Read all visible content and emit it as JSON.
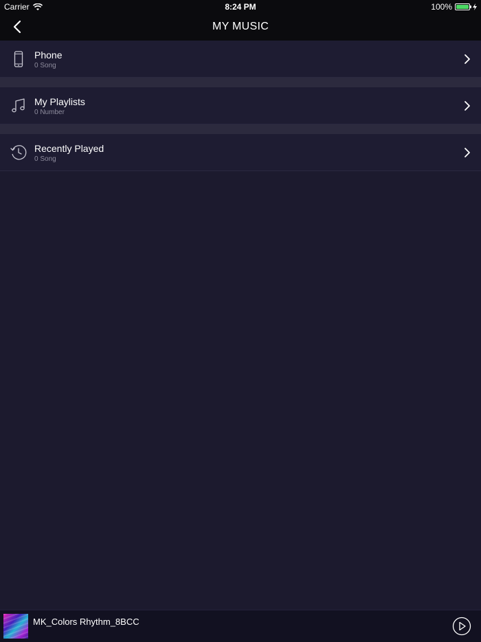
{
  "status_bar": {
    "carrier": "Carrier",
    "time": "8:24 PM",
    "battery": "100%",
    "battery_level": 1.0
  },
  "nav": {
    "title": "MY MUSIC",
    "back_icon": "chevron-left-icon"
  },
  "menu": [
    {
      "label": "Phone",
      "sub": "0 Song",
      "icon": "phone-icon"
    },
    {
      "label": "My Playlists",
      "sub": "0 Number",
      "icon": "music-note-icon"
    },
    {
      "label": "Recently Played",
      "sub": "0 Song",
      "icon": "clock-icon"
    }
  ],
  "mini_player": {
    "song": "MK_Colors Rhythm_8BCC",
    "play_icon": "play-icon"
  },
  "colors": {
    "background": "#1c1a2e",
    "bar": "#0b0b0e",
    "row": "#1e1c32",
    "separator": "#2c2a3e",
    "battery": "#4cd964"
  }
}
